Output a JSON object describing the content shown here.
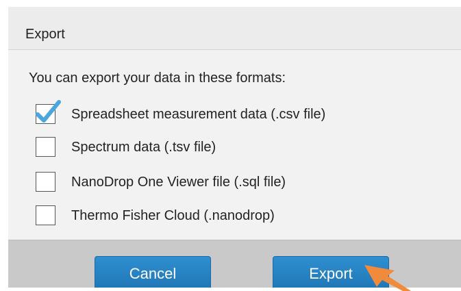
{
  "dialog": {
    "title": "Export",
    "intro": "You can export your data in these formats:",
    "options": [
      {
        "label": "Spreadsheet measurement data (.csv file)",
        "checked": true
      },
      {
        "label": "Spectrum data (.tsv file)",
        "checked": false
      },
      {
        "label": "NanoDrop One Viewer file (.sql file)",
        "checked": false
      },
      {
        "label": "Thermo Fisher Cloud (.nanodrop)",
        "checked": false
      }
    ],
    "buttons": {
      "cancel_label": "Cancel",
      "export_label": "Export"
    }
  },
  "colors": {
    "button": "#1f75b5",
    "checkmark": "#4aa6dd",
    "pointer_arrow": "#f28a3c"
  },
  "icons": {
    "check": "checkmark-icon",
    "pointer": "arrow-pointer-icon"
  }
}
